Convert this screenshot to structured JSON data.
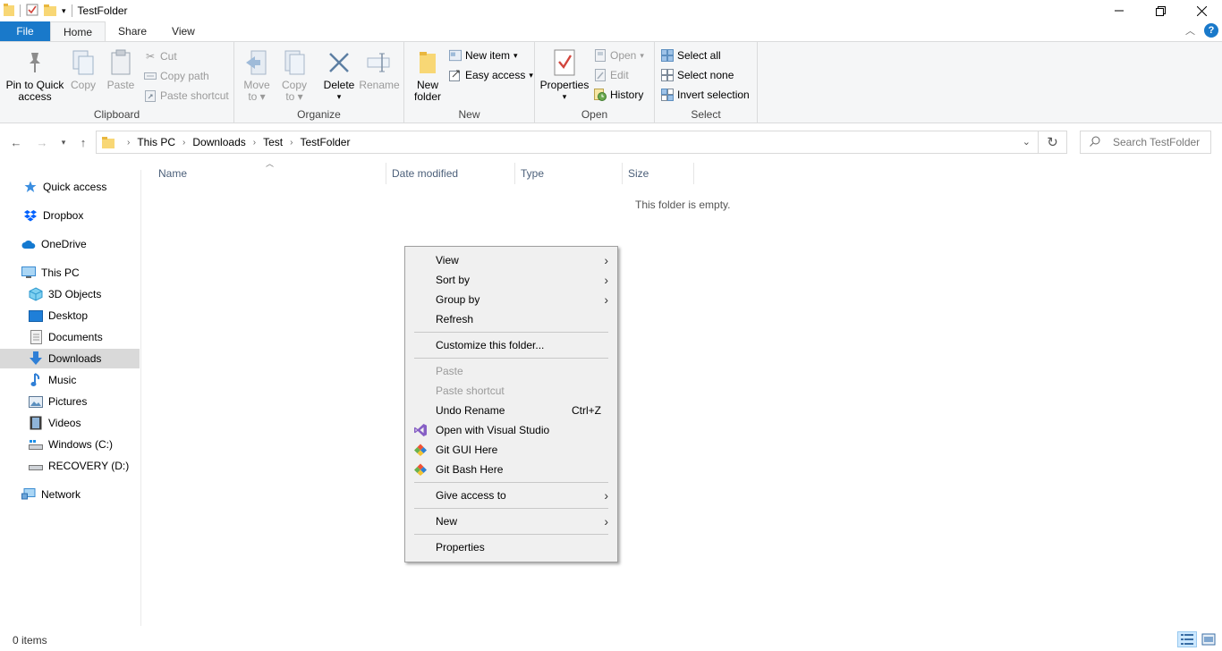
{
  "window": {
    "title": "TestFolder",
    "quick_access_icons": [
      "folder-icon",
      "properties-icon",
      "new-folder-icon",
      "customize-dropdown-icon"
    ],
    "controls": [
      "minimize-icon",
      "restore-icon",
      "close-icon"
    ]
  },
  "ribbon_tabs": [
    "File",
    "Home",
    "Share",
    "View"
  ],
  "ribbon": {
    "clipboard": {
      "label": "Clipboard",
      "pin_label": "Pin to Quick access",
      "pin_line1": "Pin to Quick",
      "pin_line2": "access",
      "copy": "Copy",
      "paste": "Paste",
      "cut": "Cut",
      "copy_path": "Copy path",
      "paste_shortcut": "Paste shortcut"
    },
    "organize": {
      "label": "Organize",
      "move_line1": "Move",
      "move_line2": "to",
      "copy_line1": "Copy",
      "copy_line2": "to",
      "delete": "Delete",
      "rename": "Rename"
    },
    "new": {
      "label": "New",
      "new_folder_line1": "New",
      "new_folder_line2": "folder",
      "new_item": "New item",
      "easy_access": "Easy access"
    },
    "open": {
      "label": "Open",
      "properties": "Properties",
      "open": "Open",
      "edit": "Edit",
      "history": "History"
    },
    "select": {
      "label": "Select",
      "select_all": "Select all",
      "select_none": "Select none",
      "invert_selection": "Invert selection"
    }
  },
  "address": {
    "breadcrumbs": [
      "This PC",
      "Downloads",
      "Test",
      "TestFolder"
    ],
    "search_placeholder": "Search TestFolder"
  },
  "nav_pane": {
    "items": [
      {
        "label": "Quick access",
        "icon": "star-icon"
      },
      {
        "label": "Dropbox",
        "icon": "dropbox-icon"
      },
      {
        "label": "OneDrive",
        "icon": "cloud-icon"
      },
      {
        "label": "This PC",
        "icon": "computer-icon"
      },
      {
        "label": "3D Objects",
        "icon": "cube-icon"
      },
      {
        "label": "Desktop",
        "icon": "desktop-icon"
      },
      {
        "label": "Documents",
        "icon": "document-icon"
      },
      {
        "label": "Downloads",
        "icon": "download-icon",
        "selected": true
      },
      {
        "label": "Music",
        "icon": "music-icon"
      },
      {
        "label": "Pictures",
        "icon": "picture-icon"
      },
      {
        "label": "Videos",
        "icon": "video-icon"
      },
      {
        "label": "Windows (C:)",
        "icon": "drive-icon"
      },
      {
        "label": "RECOVERY (D:)",
        "icon": "drive-icon"
      },
      {
        "label": "Network",
        "icon": "network-icon"
      }
    ]
  },
  "columns": [
    "Name",
    "Date modified",
    "Type",
    "Size"
  ],
  "empty_message": "This folder is empty.",
  "context_menu": {
    "items": [
      {
        "label": "View",
        "submenu": true
      },
      {
        "label": "Sort by",
        "submenu": true
      },
      {
        "label": "Group by",
        "submenu": true
      },
      {
        "label": "Refresh"
      },
      {
        "label": "Customize this folder..."
      },
      {
        "label": "Paste",
        "disabled": true
      },
      {
        "label": "Paste shortcut",
        "disabled": true
      },
      {
        "label": "Undo Rename",
        "shortcut": "Ctrl+Z"
      },
      {
        "label": "Open with Visual Studio",
        "icon": "visual-studio-icon"
      },
      {
        "label": "Git GUI Here",
        "icon": "git-icon"
      },
      {
        "label": "Git Bash Here",
        "icon": "git-icon"
      },
      {
        "label": "Give access to",
        "submenu": true
      },
      {
        "label": "New",
        "submenu": true
      },
      {
        "label": "Properties"
      }
    ]
  },
  "status": {
    "item_count": "0 items"
  },
  "colors": {
    "accent": "#1979ca",
    "ribbon_bg": "#f5f6f7",
    "menu_bg": "#f0f0f0",
    "selected_nav": "#d9d9d9",
    "disabled_text": "#9a9a9a"
  }
}
